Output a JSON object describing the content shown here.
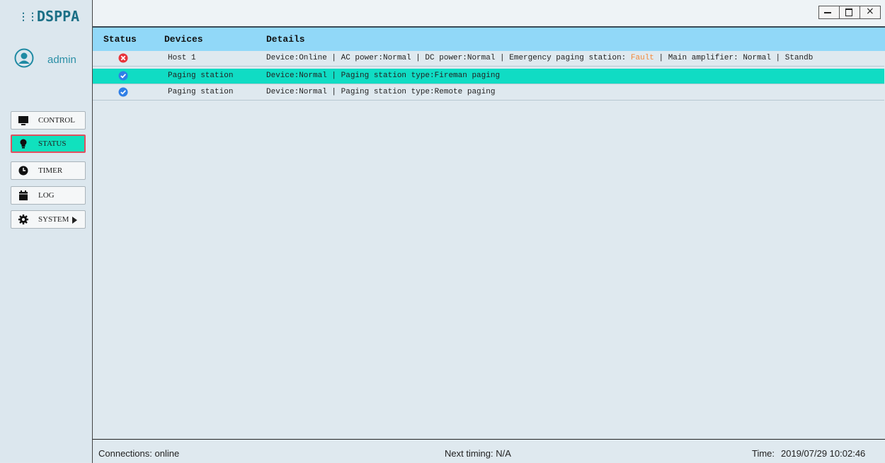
{
  "brand": {
    "logo_text": "DSPPA"
  },
  "user": {
    "name": "admin",
    "avatar_icon": "user-avatar-icon"
  },
  "nav": {
    "items": [
      {
        "label": "CONTROL",
        "icon": "monitor-icon"
      },
      {
        "label": "STATUS",
        "icon": "lightbulb-icon",
        "active": true
      },
      {
        "label": "TIMER",
        "icon": "clock-icon"
      },
      {
        "label": "LOG",
        "icon": "calendar-icon"
      },
      {
        "label": "SYSTEM",
        "icon": "gear-icon",
        "has_submenu": true
      }
    ]
  },
  "window_controls": {
    "minimize": "–",
    "maximize": "□",
    "close": "×"
  },
  "table": {
    "headers": [
      "Status",
      "Devices",
      "Details"
    ],
    "rows": [
      {
        "status": "error",
        "device": "Host 1",
        "details_prefix": "Device:Online | AC power:Normal | DC power:Normal | Emergency paging station: ",
        "details_fault": "Fault",
        "details_suffix": " | Main amplifier: Normal | Standb",
        "selected": false
      },
      {
        "status": "ok",
        "device": "Paging station",
        "details": "Device:Normal | Paging station type:Fireman paging",
        "selected": true
      },
      {
        "status": "ok",
        "device": "Paging station",
        "details": "Device:Normal | Paging station type:Remote paging",
        "selected": false
      }
    ]
  },
  "statusbar": {
    "connections": "Connections: online",
    "next_timing": "Next timing: N/A",
    "time_label": "Time:",
    "time_value": "2019/07/29  10:02:46"
  },
  "colors": {
    "header_bg": "#91d8f8",
    "selected_row": "#10dcc4",
    "active_nav": "#10e1be",
    "active_nav_border": "#e05060",
    "fault_text": "#f28a3b",
    "error_icon": "#e8333a",
    "ok_icon": "#2f7fe6"
  }
}
